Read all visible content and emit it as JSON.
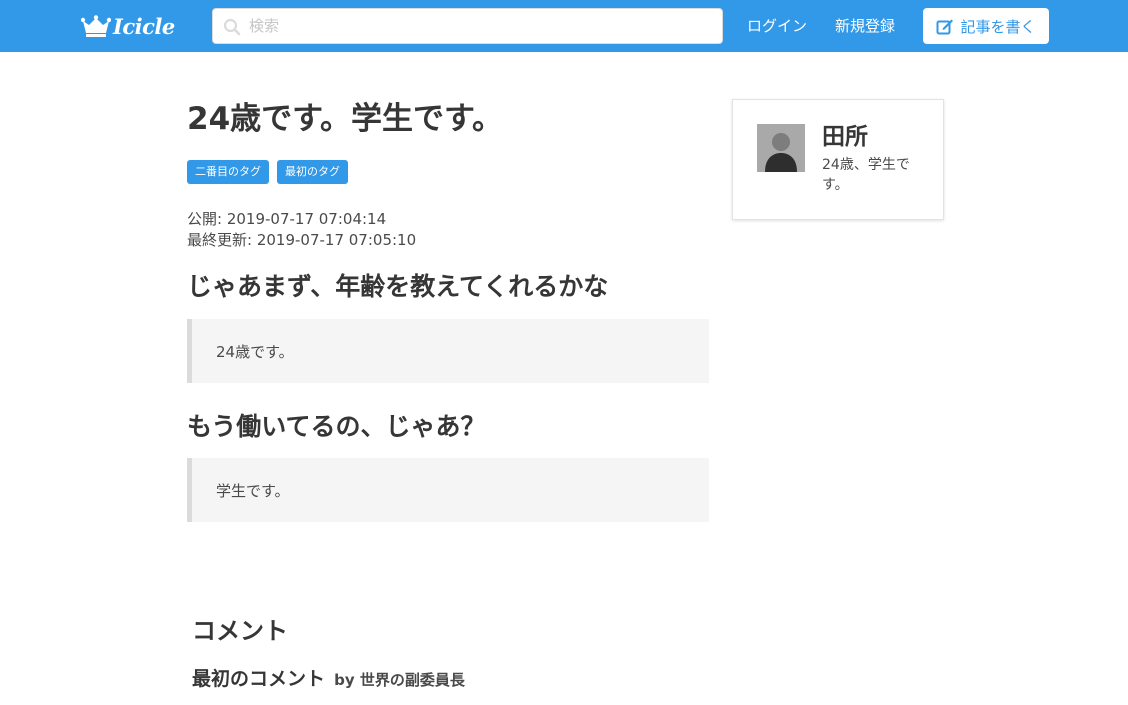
{
  "header": {
    "logo_text": "Icicle",
    "search_placeholder": "検索",
    "login_label": "ログイン",
    "signup_label": "新規登録",
    "write_label": "記事を書く",
    "accent_color": "#3298e8"
  },
  "article": {
    "title": "24歳です。学生です。",
    "tags": [
      "二番目のタグ",
      "最初のタグ"
    ],
    "published": "公開: 2019-07-17 07:04:14",
    "updated": "最終更新: 2019-07-17 07:05:10",
    "sections": [
      {
        "question": "じゃあまず、年齢を教えてくれるかな",
        "answer": "24歳です。"
      },
      {
        "question": "もう働いてるの、じゃあ？",
        "answer": "学生です。"
      }
    ]
  },
  "comments": {
    "heading": "コメント",
    "items": [
      {
        "title": "最初のコメント",
        "by": "by 世界の副委員長"
      }
    ]
  },
  "author": {
    "name": "田所",
    "bio": "24歳、学生です。"
  },
  "icons": [
    "crown-logo-icon",
    "search-icon",
    "edit-icon",
    "avatar-icon"
  ]
}
